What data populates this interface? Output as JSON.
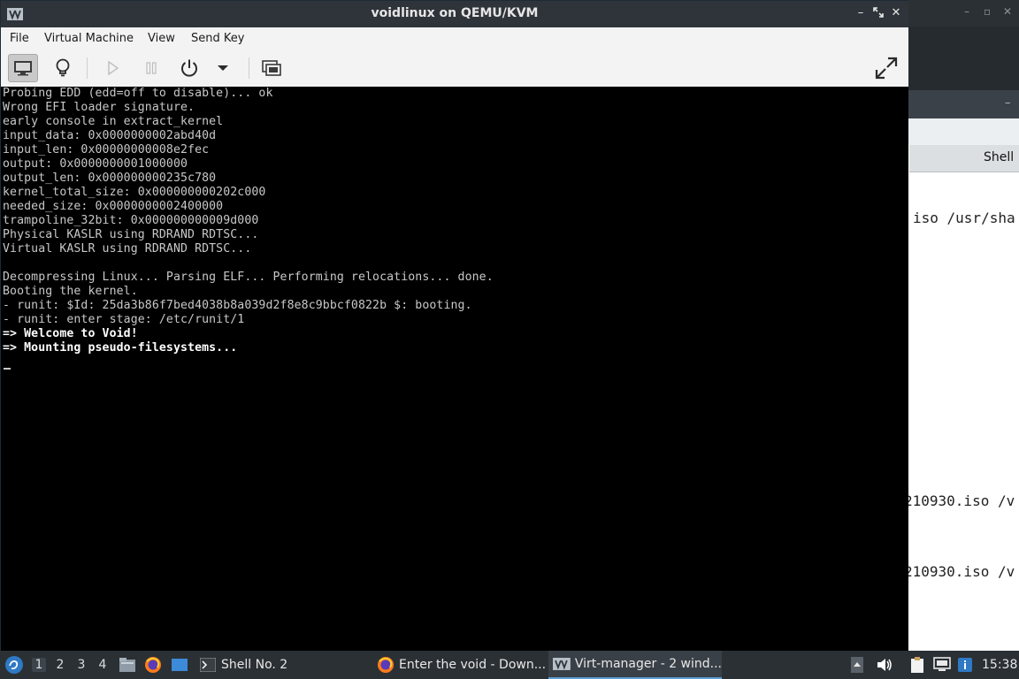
{
  "window": {
    "title": "voidlinux on QEMU/KVM"
  },
  "menu": [
    "File",
    "Virtual Machine",
    "View",
    "Send Key"
  ],
  "toolbar": {
    "buttons": [
      "console-icon",
      "details-bulb-icon",
      "run-icon",
      "pause-icon",
      "power-icon",
      "dropdown-arrow-icon",
      "snapshot-icon",
      "fullscreen-icon"
    ]
  },
  "console": {
    "lines": [
      "Probing EDD (edd=off to disable)... ok",
      "Wrong EFI loader signature.",
      "early console in extract_kernel",
      "input_data: 0x0000000002abd40d",
      "input_len: 0x00000000008e2fec",
      "output: 0x0000000001000000",
      "output_len: 0x000000000235c780",
      "kernel_total_size: 0x000000000202c000",
      "needed_size: 0x0000000002400000",
      "trampoline_32bit: 0x000000000009d000",
      "Physical KASLR using RDRAND RDTSC...",
      "Virtual KASLR using RDRAND RDTSC...",
      "",
      "Decompressing Linux... Parsing ELF... Performing relocations... done.",
      "Booting the kernel.",
      "- runit: $Id: 25da3b86f7bed4038b8a039d2f8e8c9bbcf0822b $: booting.",
      "- runit: enter stage: /etc/runit/1",
      "=> Welcome to Void!",
      "=> Mounting pseudo-filesystems..."
    ]
  },
  "background_window": {
    "tab_label": "Shell N",
    "terminal_lines": [
      "iso /usr/sha",
      "210930.iso /v",
      "210930.iso /v"
    ]
  },
  "taskbar": {
    "workspaces": [
      "1",
      "2",
      "3",
      "4"
    ],
    "tasks": [
      {
        "label": "Shell No. 2",
        "icon": "terminal-icon"
      },
      {
        "label": "Enter the void - Down...",
        "icon": "firefox-icon"
      },
      {
        "label": "Virt-manager - 2 wind...",
        "icon": "virt-manager-icon"
      }
    ],
    "clock": "15:38"
  },
  "colors": {
    "titlebar": "#2f343a",
    "menubar": "#f3f3f3",
    "console_bg": "#000000",
    "console_text": "#c8c8c8",
    "taskbar": "#2b3035",
    "accent": "#5e9fd6"
  }
}
